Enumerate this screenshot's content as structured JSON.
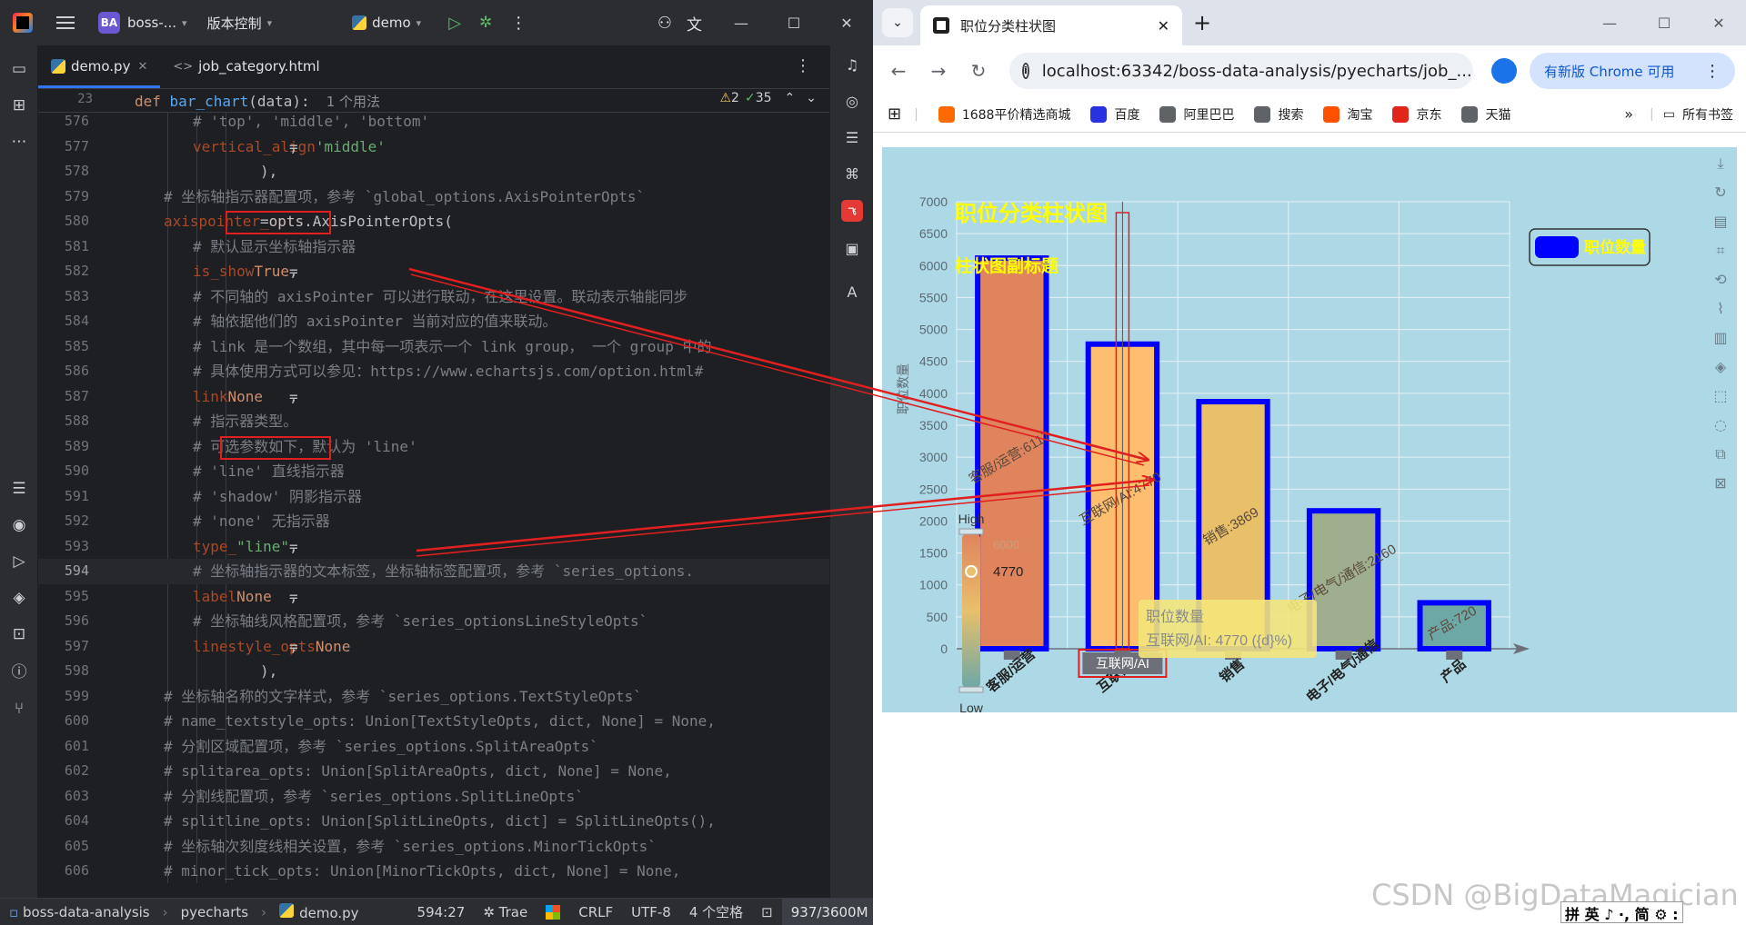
{
  "ide": {
    "project_badge": "BA",
    "project_name": "boss-...",
    "vcs_label": "版本控制",
    "run_config": "demo",
    "tabs": [
      {
        "label": "demo.py",
        "active": true
      },
      {
        "label": "job_category.html",
        "active": false
      }
    ],
    "sticky": {
      "line_num": "23",
      "code_kw": "def",
      "code_fn": "bar_chart",
      "code_rest": "(data):",
      "hint": "1 个用法",
      "warnings": "2",
      "checks": "35"
    },
    "lines": [
      {
        "n": "576",
        "indent": 4,
        "parts": [
          [
            "cm",
            "#  'top', 'middle', 'bottom'"
          ]
        ]
      },
      {
        "n": "577",
        "indent": 4,
        "parts": [
          [
            "prm",
            "vertical_align"
          ],
          [
            "tx",
            "="
          ],
          [
            "str",
            "'middle'"
          ],
          [
            "tx",
            ","
          ]
        ]
      },
      {
        "n": "578",
        "indent": 3,
        "parts": [
          [
            "tx",
            "),"
          ]
        ]
      },
      {
        "n": "579",
        "indent": 3,
        "parts": [
          [
            "cm",
            "# 坐标轴指示器配置项，参考 `global_options.AxisPointerOpts`"
          ]
        ]
      },
      {
        "n": "580",
        "indent": 3,
        "parts": [
          [
            "prm",
            "axispointer_opts"
          ],
          [
            "tx",
            "=opts.AxisPointerOpts("
          ]
        ]
      },
      {
        "n": "581",
        "indent": 4,
        "parts": [
          [
            "cm",
            "# 默认显示坐标轴指示器"
          ]
        ]
      },
      {
        "n": "582",
        "indent": 4,
        "parts": [
          [
            "prm",
            "is_show"
          ],
          [
            "tx",
            "="
          ],
          [
            "kw",
            "True"
          ],
          [
            "tx",
            ","
          ]
        ]
      },
      {
        "n": "583",
        "indent": 4,
        "parts": [
          [
            "cm",
            "# 不同轴的 axisPointer 可以进行联动，在这里设置。联动表示轴能同步"
          ]
        ]
      },
      {
        "n": "584",
        "indent": 4,
        "parts": [
          [
            "cm",
            "# 轴依据他们的 axisPointer 当前对应的值来联动。"
          ]
        ]
      },
      {
        "n": "585",
        "indent": 4,
        "parts": [
          [
            "cm",
            "# link 是一个数组，其中每一项表示一个 link group， 一个 group 中的"
          ]
        ]
      },
      {
        "n": "586",
        "indent": 4,
        "parts": [
          [
            "cm",
            "# 具体使用方式可以参见：https://www.echartsjs.com/option.html#"
          ]
        ]
      },
      {
        "n": "587",
        "indent": 4,
        "parts": [
          [
            "prm",
            "link"
          ],
          [
            "tx",
            "="
          ],
          [
            "kw",
            "None"
          ],
          [
            "tx",
            ","
          ]
        ]
      },
      {
        "n": "588",
        "indent": 4,
        "parts": [
          [
            "cm",
            "# 指示器类型。"
          ]
        ]
      },
      {
        "n": "589",
        "indent": 4,
        "parts": [
          [
            "cm",
            "# 可选参数如下，默认为 'line'"
          ]
        ]
      },
      {
        "n": "590",
        "indent": 4,
        "parts": [
          [
            "cm",
            "# 'line' 直线指示器"
          ]
        ]
      },
      {
        "n": "591",
        "indent": 4,
        "parts": [
          [
            "cm",
            "# 'shadow' 阴影指示器"
          ]
        ]
      },
      {
        "n": "592",
        "indent": 4,
        "parts": [
          [
            "cm",
            "# 'none' 无指示器"
          ]
        ]
      },
      {
        "n": "593",
        "indent": 4,
        "parts": [
          [
            "prm",
            "type_"
          ],
          [
            "tx",
            "="
          ],
          [
            "str",
            "\"line\""
          ],
          [
            "tx",
            ","
          ]
        ]
      },
      {
        "n": "594",
        "indent": 4,
        "parts": [
          [
            "cm",
            "# 坐标轴指示器的文本标签，坐标轴标签配置项，参考 `series_options."
          ]
        ]
      },
      {
        "n": "595",
        "indent": 4,
        "parts": [
          [
            "prm",
            "label"
          ],
          [
            "tx",
            "="
          ],
          [
            "kw",
            "None"
          ],
          [
            "tx",
            ","
          ]
        ]
      },
      {
        "n": "596",
        "indent": 4,
        "parts": [
          [
            "cm",
            "# 坐标轴线风格配置项，参考 `series_optionsLineStyleOpts`"
          ]
        ]
      },
      {
        "n": "597",
        "indent": 4,
        "parts": [
          [
            "prm",
            "linestyle_opts"
          ],
          [
            "tx",
            "="
          ],
          [
            "kw",
            "None"
          ],
          [
            "tx",
            ","
          ]
        ]
      },
      {
        "n": "598",
        "indent": 3,
        "parts": [
          [
            "tx",
            "),"
          ]
        ]
      },
      {
        "n": "599",
        "indent": 3,
        "parts": [
          [
            "cm",
            "#     坐标轴名称的文字样式，参考 `series_options.TextStyleOpts`"
          ]
        ]
      },
      {
        "n": "600",
        "indent": 3,
        "parts": [
          [
            "cm",
            "# name_textstyle_opts: Union[TextStyleOpts, dict, None] = None,"
          ]
        ]
      },
      {
        "n": "601",
        "indent": 3,
        "parts": [
          [
            "cm",
            "#     分割区域配置项，参考 `series_options.SplitAreaOpts`"
          ]
        ]
      },
      {
        "n": "602",
        "indent": 3,
        "parts": [
          [
            "cm",
            "# splitarea_opts: Union[SplitAreaOpts, dict, None] = None,"
          ]
        ]
      },
      {
        "n": "603",
        "indent": 3,
        "parts": [
          [
            "cm",
            "#     分割线配置项，参考 `series_options.SplitLineOpts`"
          ]
        ]
      },
      {
        "n": "604",
        "indent": 3,
        "parts": [
          [
            "cm",
            "# splitline_opts: Union[SplitLineOpts, dict] = SplitLineOpts(),"
          ]
        ]
      },
      {
        "n": "605",
        "indent": 3,
        "parts": [
          [
            "cm",
            "#     坐标轴次刻度线相关设置，参考 `series_options.MinorTickOpts`"
          ]
        ]
      },
      {
        "n": "606",
        "indent": 3,
        "parts": [
          [
            "cm",
            "# minor_tick_opts: Union[MinorTickOpts, dict, None] = None,"
          ]
        ]
      }
    ],
    "status": {
      "path": [
        "boss-data-analysis",
        "pyecharts",
        "demo.py"
      ],
      "position": "594:27",
      "trae": "Trae",
      "line_sep": "CRLF",
      "encoding": "UTF-8",
      "indent": "4 个空格",
      "memory": "937/3600M"
    }
  },
  "browser": {
    "tab_title": "职位分类柱状图",
    "url": "localhost:63342/boss-data-analysis/pyecharts/job_...",
    "update_label": "有新版 Chrome 可用",
    "bookmarks": [
      "1688平价精选商城",
      "百度",
      "阿里巴巴",
      "搜索",
      "淘宝",
      "京东",
      "天猫"
    ],
    "bookmarks_all": "所有书签",
    "bookmark_colors": [
      "#ff6a00",
      "#2932e1",
      "#5f6368",
      "#5f6368",
      "#ff5000",
      "#e1251b",
      "#5f6368"
    ]
  },
  "chart_data": {
    "type": "bar",
    "title": "职位分类柱状图",
    "subtitle": "柱状图副标题",
    "ylabel": "职位数量",
    "ylim": [
      0,
      7000
    ],
    "yticks": [
      0,
      500,
      1000,
      1500,
      2000,
      2500,
      3000,
      3500,
      4000,
      4500,
      5000,
      5500,
      6000,
      6500,
      7000
    ],
    "categories": [
      "客服/运营",
      "互联网/AI",
      "销售",
      "电子/电气/通信",
      "产品"
    ],
    "series": [
      {
        "name": "职位数量",
        "values": [
          6117,
          4770,
          3869,
          2160,
          720
        ]
      }
    ],
    "data_labels": [
      "客服/运营:6117",
      "互联网/AI:4770",
      "销售:3869",
      "电子/电气/通信:2160",
      "产品:720"
    ],
    "bar_colors": [
      "#e0845e",
      "#fdbf6f",
      "#e8c06a",
      "#9fae8c",
      "#6ea8a6"
    ],
    "bar_border_color": "#0000ff",
    "legend_position": "top-right",
    "visual_map": {
      "high": "High",
      "low": "Low",
      "max": 6000,
      "current": 4770
    },
    "tooltip": {
      "title": "职位数量",
      "line": "互联网/AI: 4770 ({d}%)"
    },
    "axis_pointer_label": "互联网/AI",
    "axis_pointer_type": "line",
    "hovered_category": "互联网/AI",
    "colors": {
      "title": "#ffff00",
      "background": "#add8e6"
    }
  },
  "watermark": "CSDN @BigDataMagician",
  "ime": "拼 英 ♪ ·, 简 ⚙ :"
}
